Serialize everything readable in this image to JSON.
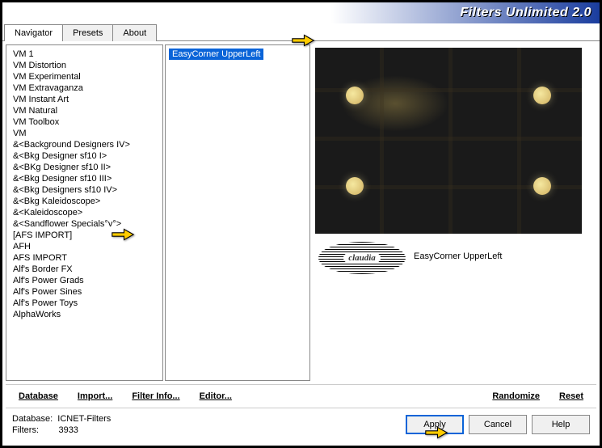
{
  "title": "Filters Unlimited 2.0",
  "tabs": {
    "navigator": "Navigator",
    "presets": "Presets",
    "about": "About"
  },
  "filter_categories": [
    "VM 1",
    "VM Distortion",
    "VM Experimental",
    "VM Extravaganza",
    "VM Instant Art",
    "VM Natural",
    "VM Toolbox",
    "VM",
    "&<Background Designers IV>",
    "&<Bkg Designer sf10 I>",
    "&<BKg Designer sf10 II>",
    "&<Bkg Designer sf10 III>",
    "&<Bkg Designers sf10 IV>",
    "&<Bkg Kaleidoscope>",
    "&<Kaleidoscope>",
    "&<Sandflower Specials°v°>",
    "[AFS IMPORT]",
    "AFH",
    "AFS IMPORT",
    "Alf's Border FX",
    "Alf's Power Grads",
    "Alf's Power Sines",
    "Alf's Power Toys",
    "AlphaWorks"
  ],
  "selected_filter": "EasyCorner UpperLeft",
  "filter_name_label": "EasyCorner UpperLeft",
  "logo_text": "claudia",
  "toolbar": {
    "database": "Database",
    "import": "Import...",
    "filter_info": "Filter Info...",
    "editor": "Editor...",
    "randomize": "Randomize",
    "reset": "Reset"
  },
  "footer": {
    "db_label": "Database:",
    "db_value": "ICNET-Filters",
    "filters_label": "Filters:",
    "filters_value": "3933",
    "apply": "Apply",
    "cancel": "Cancel",
    "help": "Help"
  }
}
